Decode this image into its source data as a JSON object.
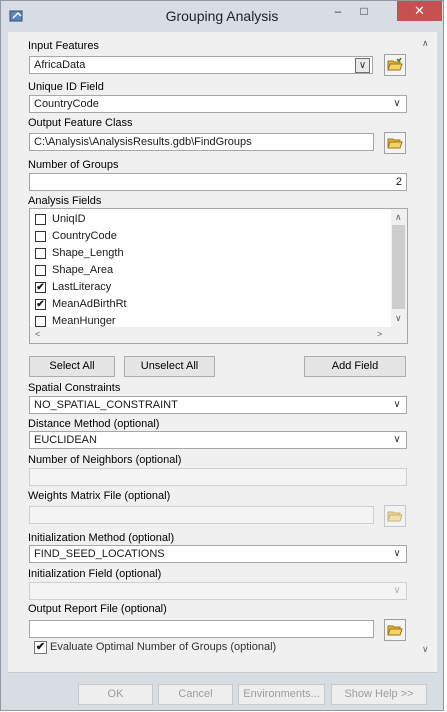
{
  "window": {
    "title": "Grouping Analysis",
    "minimize": "–",
    "maximize": "□",
    "close": "✕"
  },
  "input_features": {
    "label": "Input Features",
    "value": "AfricaData"
  },
  "unique_id": {
    "label": "Unique ID Field",
    "value": "CountryCode"
  },
  "output_feature_class": {
    "label": "Output Feature Class",
    "value": "C:\\Analysis\\AnalysisResults.gdb\\FindGroups"
  },
  "number_of_groups": {
    "label": "Number of Groups",
    "value": "2"
  },
  "analysis_fields": {
    "label": "Analysis Fields",
    "items": [
      {
        "label": "UniqID",
        "checked": false
      },
      {
        "label": "CountryCode",
        "checked": false
      },
      {
        "label": "Shape_Length",
        "checked": false
      },
      {
        "label": "Shape_Area",
        "checked": false
      },
      {
        "label": "LastLiteracy",
        "checked": true
      },
      {
        "label": "MeanAdBirthRt",
        "checked": true
      },
      {
        "label": "MeanHunger",
        "checked": false
      }
    ]
  },
  "buttons": {
    "select_all": "Select All",
    "unselect_all": "Unselect All",
    "add_field": "Add Field"
  },
  "spatial_constraints": {
    "label": "Spatial Constraints",
    "value": "NO_SPATIAL_CONSTRAINT"
  },
  "distance_method": {
    "label": "Distance Method (optional)",
    "value": "EUCLIDEAN"
  },
  "number_of_neighbors": {
    "label": "Number of Neighbors (optional)",
    "value": ""
  },
  "weights_matrix": {
    "label": "Weights Matrix File (optional)",
    "value": ""
  },
  "initialization_method": {
    "label": "Initialization Method (optional)",
    "value": "FIND_SEED_LOCATIONS"
  },
  "initialization_field": {
    "label": "Initialization Field (optional)",
    "value": ""
  },
  "output_report": {
    "label": "Output Report File (optional)",
    "value": ""
  },
  "evaluate_optimal": {
    "label": "Evaluate Optimal Number of Groups (optional)",
    "checked": true
  },
  "footer": {
    "ok": "OK",
    "cancel": "Cancel",
    "environments": "Environments...",
    "show_help": "Show Help >>"
  },
  "check_glyph": "✔",
  "arrow_down": "∨",
  "arrow_up": "∧",
  "arrow_left": "<",
  "arrow_right": ">",
  "icons": {
    "app": "arcgis-tool-icon",
    "folder": "open-folder-icon",
    "dropdown": "chevron-down-icon"
  },
  "colors": {
    "close_button": "#c75050",
    "window_frame": "#d8dde4",
    "folder_yellow": "#e8b830"
  }
}
